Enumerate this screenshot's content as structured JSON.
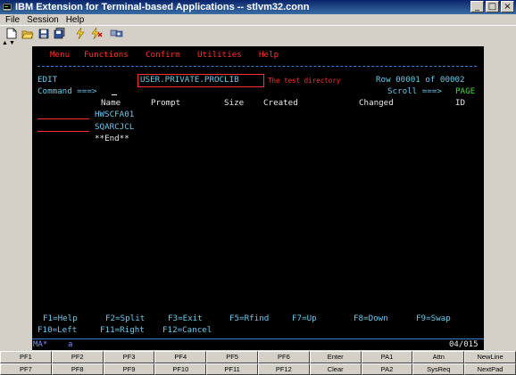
{
  "window": {
    "title": "IBM Extension for Terminal-based Applications -- stlvm32.conn",
    "minimize": "_",
    "maximize": "□",
    "close": "×"
  },
  "menubar": [
    "File",
    "Session",
    "Help"
  ],
  "toolbar": {
    "icons": [
      "new-icon",
      "open-icon",
      "save-icon",
      "save-all-icon",
      "connect-icon",
      "disconnect-icon",
      "settings-icon"
    ]
  },
  "terminal": {
    "menu": [
      "Menu",
      "Functions",
      "Confirm",
      "Utilities",
      "Help"
    ],
    "mode": "EDIT",
    "dataset": "USER.PRIVATE.PROCLIB",
    "annotation": "The test directory",
    "row_info": "Row 00001 of 00002",
    "command_label": "Command ===>",
    "scroll_label": "Scroll ===>",
    "scroll_value": "PAGE",
    "columns": [
      "Name",
      "Prompt",
      "Size",
      "Created",
      "Changed",
      "ID"
    ],
    "members": [
      "HWSCFA01",
      "SQARCJCL"
    ],
    "end_marker": "**End**",
    "fkeys_row1": [
      "F1=Help",
      "F2=Split",
      "F3=Exit",
      "F5=Rfind",
      "F7=Up",
      "F8=Down",
      "F9=Swap"
    ],
    "fkeys_row2": [
      "F10=Left",
      "F11=Right",
      "F12=Cancel"
    ]
  },
  "status": {
    "left": "MA*",
    "mode": "a",
    "cursor_pos": "04/015"
  },
  "pfkeys": {
    "row1": [
      "PF1",
      "PF2",
      "PF3",
      "PF4",
      "PF5",
      "PF6",
      "Enter",
      "PA1",
      "Attn",
      "NewLine"
    ],
    "row2": [
      "PF7",
      "PF8",
      "PF9",
      "PF10",
      "PF11",
      "PF12",
      "Clear",
      "PA2",
      "SysReq",
      "NextPad"
    ]
  },
  "colors": {
    "terminal_bg": "#000000",
    "red": "#ff3030",
    "green": "#3ee03e",
    "cyan": "#6dc8e8",
    "titlebar": "#0a246a"
  }
}
